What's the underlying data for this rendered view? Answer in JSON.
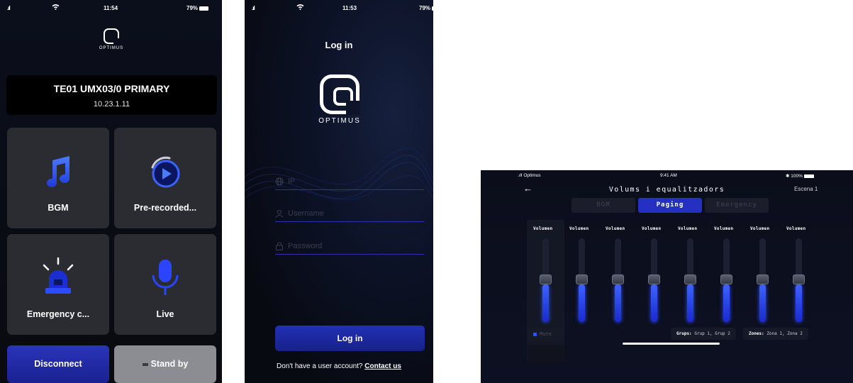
{
  "screen1": {
    "status": {
      "signal": ".ıl",
      "time": "11:54",
      "battery": "79%"
    },
    "logo_word": "OPTIMUS",
    "device": {
      "name": "TE01 UMX03/0 PRIMARY",
      "ip": "10.23.1.11"
    },
    "tiles": [
      {
        "label": "BGM",
        "icon": "music-note-icon"
      },
      {
        "label": "Pre-recorded...",
        "icon": "play-circle-icon"
      },
      {
        "label": "Emergency c...",
        "icon": "siren-icon"
      },
      {
        "label": "Live",
        "icon": "microphone-icon"
      }
    ],
    "disconnect_label": "Disconnect",
    "standby_label": "Stand by"
  },
  "screen2": {
    "status": {
      "signal": ".ıl",
      "time": "11:53",
      "battery": "79%"
    },
    "title": "Log in",
    "logo_word": "OPTIMUS",
    "fields": [
      {
        "placeholder": "IP",
        "icon": "globe-icon"
      },
      {
        "placeholder": "Username",
        "icon": "user-icon"
      },
      {
        "placeholder": "Password",
        "icon": "lock-icon"
      }
    ],
    "login_label": "Log in",
    "signup_text": "Don't have a user account?",
    "signup_link": "Contact us"
  },
  "screen3": {
    "status": {
      "carrier": "Optimus",
      "time": "9:41 AM",
      "battery": "100%"
    },
    "title": "Volums i equalitzadors",
    "scene": "Escena 1",
    "tabs": [
      {
        "label": "BGM",
        "active": false
      },
      {
        "label": "Paging",
        "active": true
      },
      {
        "label": "Emergency",
        "active": false
      }
    ],
    "channels": [
      {
        "label": "Volumen",
        "level": 0.45
      },
      {
        "label": "Volumen",
        "level": 0.45
      },
      {
        "label": "Volumen",
        "level": 0.45
      },
      {
        "label": "Volumen",
        "level": 0.45
      },
      {
        "label": "Volumen",
        "level": 0.45
      },
      {
        "label": "Volumen",
        "level": 0.45
      },
      {
        "label": "Volumen",
        "level": 0.45
      },
      {
        "label": "Volumen",
        "level": 0.45
      }
    ],
    "mute_label": "Mute",
    "groups_key": "Grups:",
    "groups_value": "Grup 1, Grup 2",
    "zones_key": "Zones:",
    "zones_value": "Zona 1, Zona 2"
  },
  "colors": {
    "accent": "#2430c2",
    "tile": "#2b2c31",
    "standby": "#8c8d92"
  }
}
